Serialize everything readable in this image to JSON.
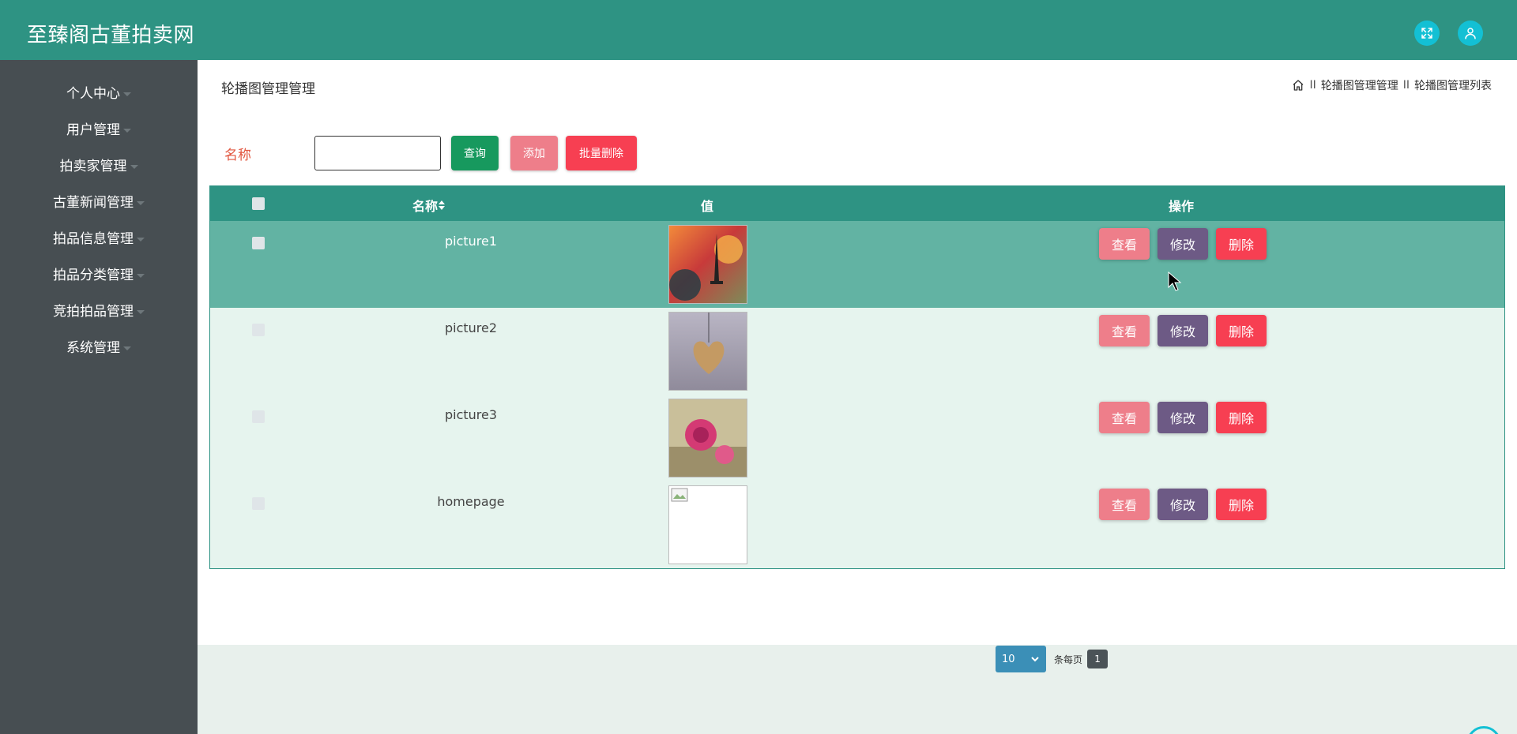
{
  "header": {
    "brand": "至臻阁古董拍卖网",
    "fullscreen_icon": "expand-icon",
    "user_icon": "user-icon"
  },
  "sidebar": {
    "items": [
      {
        "label": "个人中心"
      },
      {
        "label": "用户管理"
      },
      {
        "label": "拍卖家管理"
      },
      {
        "label": "古董新闻管理"
      },
      {
        "label": "拍品信息管理"
      },
      {
        "label": "拍品分类管理"
      },
      {
        "label": "竞拍拍品管理"
      },
      {
        "label": "系统管理"
      }
    ]
  },
  "page": {
    "title": "轮播图管理管理",
    "breadcrumb": [
      "轮播图管理管理",
      "轮播图管理列表"
    ],
    "breadcrumb_separator": "II"
  },
  "search": {
    "label": "名称",
    "value": "",
    "query_button": "查询",
    "add_button": "添加",
    "batch_delete_button": "批量删除"
  },
  "table": {
    "headers": {
      "name": "名称",
      "value": "值",
      "actions": "操作"
    },
    "rows": [
      {
        "name": "picture1",
        "image": "eiffel-tower-flowers",
        "highlighted": true
      },
      {
        "name": "picture2",
        "image": "heart-pendant"
      },
      {
        "name": "picture3",
        "image": "pink-roses"
      },
      {
        "name": "homepage",
        "image": "broken-image"
      }
    ],
    "actions": {
      "view": "查看",
      "edit": "修改",
      "delete": "删除"
    }
  },
  "pagination": {
    "page_size": "10",
    "per_page_label": "条每页",
    "current_page": "1"
  },
  "colors": {
    "header": "#2e9383",
    "sidebar": "#474e52",
    "row_highlight": "#62b3a3",
    "row_bg": "#e6f4ee",
    "view_button": "#ee7e8a",
    "edit_button": "#6d5a85",
    "delete_button": "#f73f52",
    "query_button": "#17995e"
  }
}
